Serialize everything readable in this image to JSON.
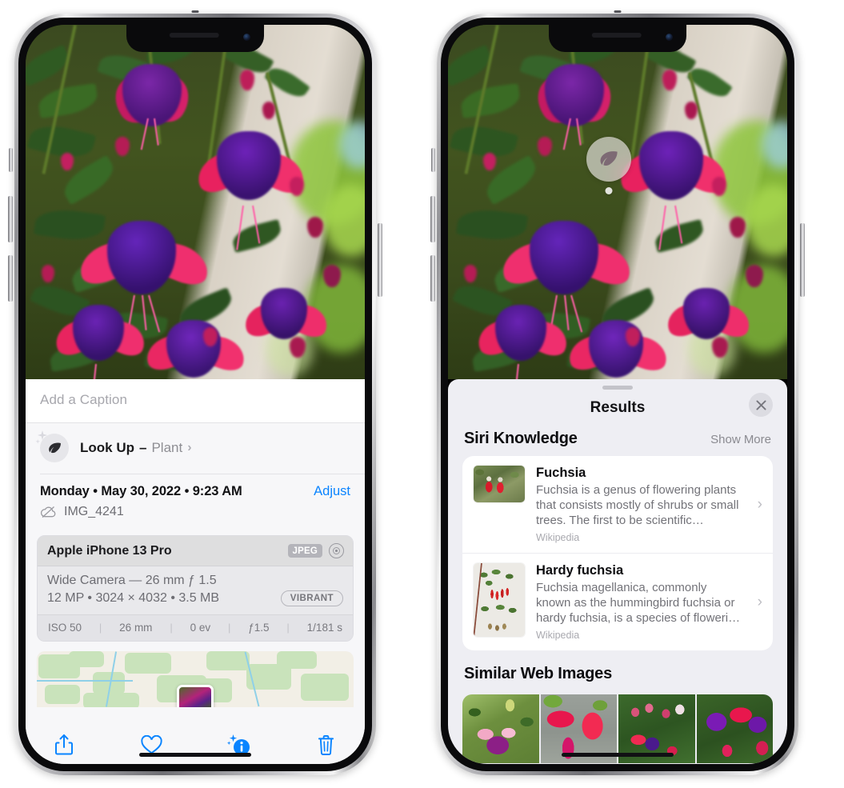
{
  "left_phone": {
    "name": "photos-detail-view",
    "caption_field": {
      "placeholder": "Add a Caption",
      "value": ""
    },
    "lookup_row": {
      "icon": "leaf-icon",
      "sparkle_icon": "sparkle-icon",
      "label": "Look Up",
      "dash": "–",
      "subject": "Plant",
      "chevron": "›"
    },
    "date_row": {
      "weekday": "Monday",
      "sep": "•",
      "date": "May 30, 2022",
      "time": "9:23 AM",
      "full": "Monday • May 30, 2022 • 9:23 AM",
      "adjust_label": "Adjust"
    },
    "file_row": {
      "icon": "cloud-slash-icon",
      "filename": "IMG_4241"
    },
    "camera_card": {
      "model": "Apple iPhone 13 Pro",
      "format_badge": "JPEG",
      "lens_icon": "lens-icon",
      "lens_line": "Wide Camera — 26 mm ƒ 1.5",
      "specs_line": "12 MP • 3024 × 4032 • 3.5 MB",
      "style_badge": "VIBRANT",
      "exif": [
        {
          "label": "ISO 50"
        },
        {
          "label": "26 mm"
        },
        {
          "label": "0 ev"
        },
        {
          "label": "ƒ1.5"
        },
        {
          "label": "1/181 s"
        }
      ]
    },
    "map_card": {
      "name": "map-preview",
      "pin": "photo-pin"
    },
    "toolbar": [
      {
        "name": "share-button",
        "icon": "share-icon"
      },
      {
        "name": "favorite-button",
        "icon": "heart-icon"
      },
      {
        "name": "info-button",
        "icon": "info-sparkle-icon"
      },
      {
        "name": "delete-button",
        "icon": "trash-icon"
      }
    ]
  },
  "right_phone": {
    "name": "visual-look-up-results",
    "badge": {
      "icon": "leaf-icon",
      "label": "visual-look-up-badge"
    },
    "sheet": {
      "grabber": "drag-handle",
      "title": "Results",
      "close_icon": "close-icon"
    },
    "siri_knowledge": {
      "section_title": "Siri Knowledge",
      "show_more": "Show More",
      "items": [
        {
          "title": "Fuchsia",
          "description": "Fuchsia is a genus of flowering plants that consists mostly of shrubs or small trees. The first to be scientific…",
          "source": "Wikipedia",
          "thumb": "fuchsia-red-flowers-thumb",
          "chevron": "›"
        },
        {
          "title": "Hardy fuchsia",
          "description": "Fuchsia magellanica, commonly known as the hummingbird fuchsia or hardy fuchsia, is a species of floweri…",
          "source": "Wikipedia",
          "thumb": "hardy-fuchsia-specimen-thumb",
          "chevron": "›"
        }
      ]
    },
    "similar_web_images": {
      "section_title": "Similar Web Images",
      "items": [
        {
          "name": "similar-image-1"
        },
        {
          "name": "similar-image-2"
        },
        {
          "name": "similar-image-3"
        },
        {
          "name": "similar-image-4"
        }
      ]
    }
  },
  "colors": {
    "accent_blue": "#0a84ff",
    "sheet_bg": "#eeeef3",
    "info_bg": "#f7f7f9",
    "card_bg": "#ffffff",
    "secondary_text": "#8e8e93",
    "badge_gray": "#b4b4ba"
  }
}
